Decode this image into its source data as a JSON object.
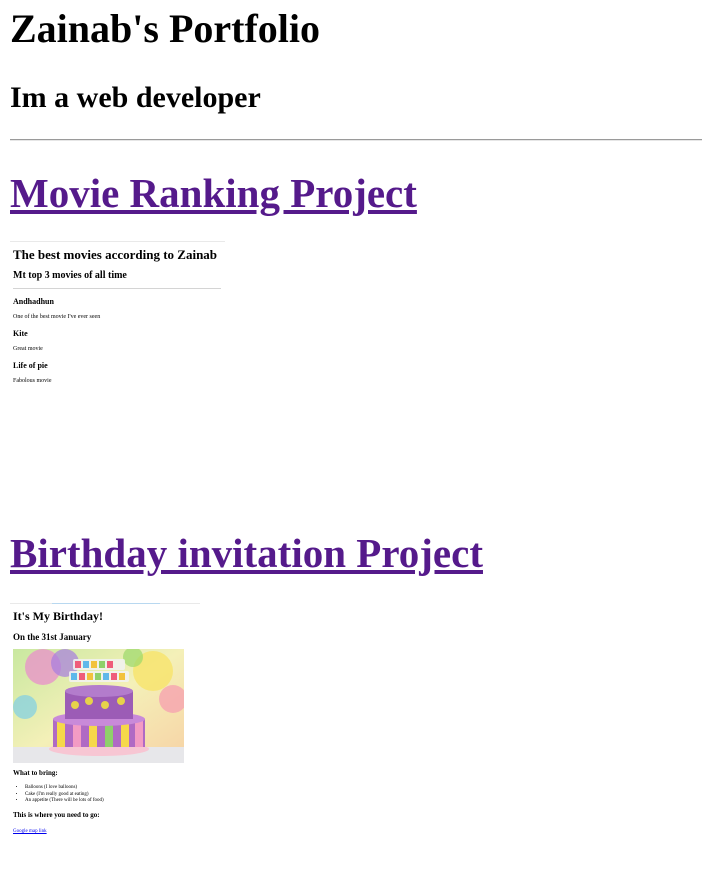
{
  "header": {
    "title": "Zainab's Portfolio",
    "subtitle": "Im a web developer"
  },
  "projects": [
    {
      "link_label": "Movie Ranking Project",
      "preview": {
        "heading": "The best movies according to Zainab",
        "subheading": "Mt top 3 movies of all time",
        "movies": [
          {
            "title": "Andhadhun",
            "note": "One of the best movie I've ever seen"
          },
          {
            "title": "Kite",
            "note": "Great movie"
          },
          {
            "title": "Life of pie",
            "note": "Fabolous movie"
          }
        ]
      }
    },
    {
      "link_label": "Birthday invitation Project",
      "preview": {
        "heading": "It's My Birthday!",
        "date": "On the 31st January",
        "image_alt": "birthday-cake",
        "bring_heading": "What to bring:",
        "bring_items": [
          "Balloons (I love balloons)",
          "Cake (I'm really good at eating)",
          "An appetite (There will be lots of food)"
        ],
        "location_heading": "This is where you need to go:",
        "map_link": "Google map link"
      }
    }
  ],
  "colors": {
    "visited_link": "#551a8b",
    "link": "#0000ee",
    "rule": "#9a9a9a"
  }
}
